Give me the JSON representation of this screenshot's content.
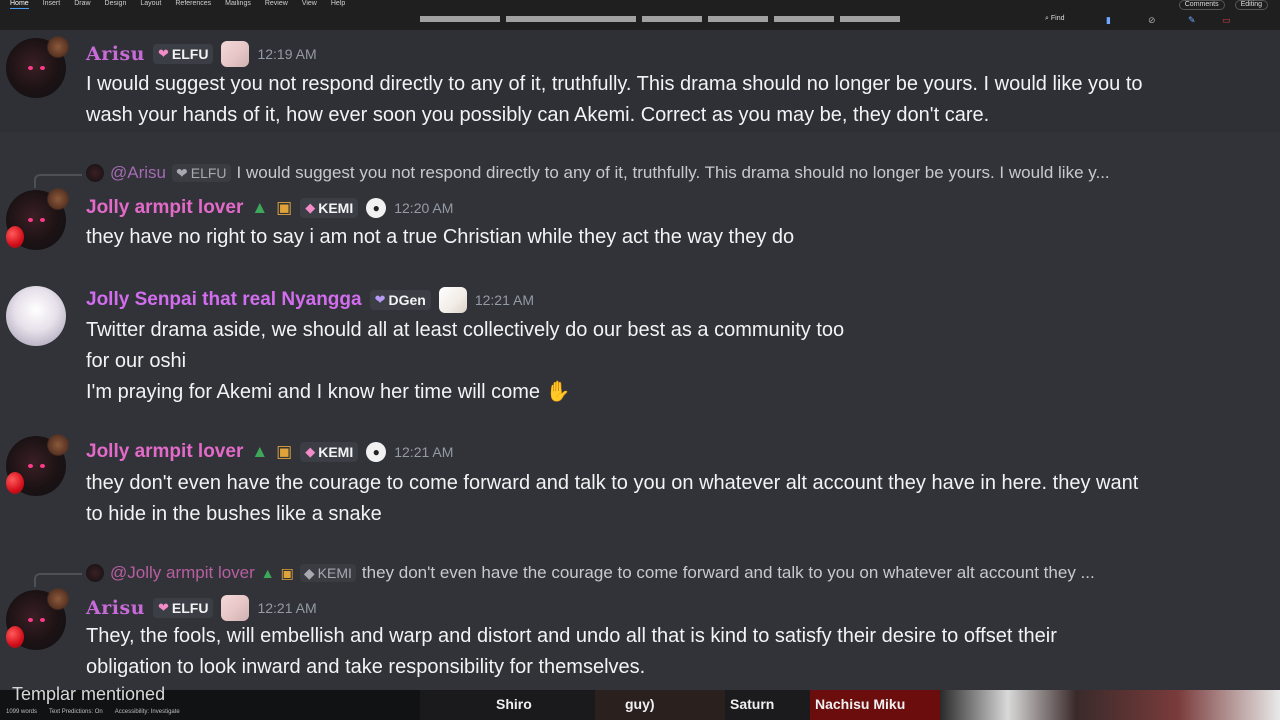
{
  "ribbon": {
    "tabs": [
      "Home",
      "Insert",
      "Draw",
      "Design",
      "Layout",
      "References",
      "Mailings",
      "Review",
      "View",
      "Help"
    ],
    "find_label": "Find",
    "comments_label": "Comments",
    "editing_label": "Editing"
  },
  "messages": [
    {
      "author": "Arisu",
      "tag": "ELFU",
      "time": "12:19 AM",
      "lines": [
        "I would suggest you not respond directly to any of it, truthfully. This drama should no longer be yours. I would like you to",
        "wash your hands of it, how ever soon you possibly can Akemi. Correct as you may be, they don't care."
      ]
    },
    {
      "reply": {
        "author": "@Arisu",
        "tag": "ELFU",
        "text": "I would suggest you not respond directly to any of it, truthfully. This drama should no longer be yours. I would like y..."
      },
      "author": "Jolly armpit lover",
      "tag": "KEMI",
      "time": "12:20 AM",
      "lines": [
        "they have no right to say i am not a true Christian while they act the way they do"
      ]
    },
    {
      "author": "Jolly Senpai that real Nyangga",
      "tag": "DGen",
      "time": "12:21 AM",
      "lines": [
        "Twitter drama aside, we should all at least collectively do our best as a community too",
        "for our oshi",
        "I'm praying for Akemi and I know her time will come"
      ]
    },
    {
      "author": "Jolly armpit lover",
      "tag": "KEMI",
      "time": "12:21 AM",
      "lines": [
        "they don't even have the courage to come forward and talk to you on whatever alt account they have in here. they want",
        "to hide in the bushes like a snake"
      ]
    },
    {
      "reply": {
        "author": "@Jolly armpit lover",
        "tag": "KEMI",
        "text": "they don't even have the courage to come forward and talk to you on whatever alt account they ..."
      },
      "author": "Arisu",
      "tag": "ELFU",
      "time": "12:21 AM",
      "lines": [
        "They, the fools, will embellish and warp and distort and undo all that is kind to satisfy their desire to offset their",
        "obligation to look inward and take responsibility for themselves."
      ]
    }
  ],
  "bottom": {
    "mention_text": "Templar mentioned",
    "status": [
      "1099 words",
      "Text Predictions: On",
      "Accessibility: Investigate"
    ],
    "members": [
      "Shiro",
      "guy)",
      "Saturn",
      "Nachisu Miku"
    ]
  },
  "colors": {
    "background": "#313338",
    "arisu_name": "#c96ad9",
    "jolly_name": "#e36ac8",
    "senpai_name": "#d36df0",
    "timestamp": "#949ba4",
    "text": "#f2f3f5"
  },
  "icons": [
    "heart-icon",
    "christmas-tree-icon",
    "gift-icon",
    "cat-icon",
    "paw-icon",
    "folded-hands-icon"
  ]
}
